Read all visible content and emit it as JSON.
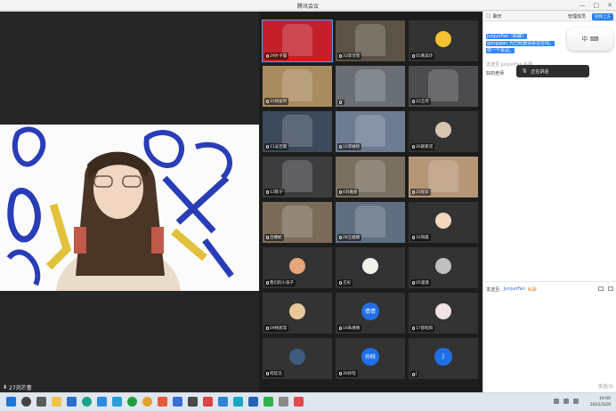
{
  "window": {
    "title": "腾讯会议",
    "min_glyph": "—",
    "max_glyph": "□",
    "close_glyph": "✕"
  },
  "main_video": {
    "speaker_name": "27刘芒蕾",
    "speaker_mic_icon": "mic-icon"
  },
  "participants": [
    {
      "label": "29叶子晨",
      "kind": "video",
      "bg": "#c3202a"
    },
    {
      "label": "33李可欣",
      "kind": "video",
      "bg": "#5b5346"
    },
    {
      "label": "05黄美玲",
      "kind": "avatar",
      "bg": "#2b2b2b",
      "avatar_color": "#f2c230"
    },
    {
      "label": "31杨盈珂",
      "kind": "video",
      "bg": "#a88c5e"
    },
    {
      "label": "",
      "kind": "video",
      "bg": "#6a6f75"
    },
    {
      "label": "22王芮",
      "kind": "video",
      "bg": "#4b4b50"
    },
    {
      "label": "11吴佳晨",
      "kind": "video",
      "bg": "#3c4a5c"
    },
    {
      "label": "10李敏彤",
      "kind": "video",
      "bg": "#6d7c93"
    },
    {
      "label": "26颜家诺",
      "kind": "avatar",
      "bg": "#2f2f2f",
      "avatar_color": "#d9c6b2"
    },
    {
      "label": "13陈宁",
      "kind": "video",
      "bg": "#3d3d40"
    },
    {
      "label": "4刘雅丽",
      "kind": "video",
      "bg": "#7a7060"
    },
    {
      "label": "25程军",
      "kind": "video",
      "bg": "#b59777"
    },
    {
      "label": "吕娜妮",
      "kind": "video",
      "bg": "#7b6c5a"
    },
    {
      "label": "28王雅楠",
      "kind": "video",
      "bg": "#5f6f80"
    },
    {
      "label": "32阳晨",
      "kind": "avatar",
      "bg": "#2f2f2f",
      "avatar_color": "#f0d7bd"
    },
    {
      "label": "我们的小孩子",
      "kind": "avatar",
      "bg": "#2f2f2f",
      "avatar_color": "#e6a67a"
    },
    {
      "label": "王祀",
      "kind": "avatar",
      "bg": "#2f2f2f",
      "avatar_color": "#f5f0ea"
    },
    {
      "label": "05潇潇",
      "kind": "avatar",
      "bg": "#2f2f2f",
      "avatar_color": "#bfbfbf"
    },
    {
      "label": "09杨宸常",
      "kind": "avatar",
      "bg": "#2f2f2f",
      "avatar_color": "#e7c79a"
    },
    {
      "label": "19朱倩倩",
      "kind": "avatar_text",
      "bg": "#2f2f2f",
      "avatar_text": "倩倩"
    },
    {
      "label": "17邵程阳",
      "kind": "avatar",
      "bg": "#2f2f2f",
      "avatar_color": "#f2e2e2"
    },
    {
      "label": "何延沅",
      "kind": "avatar",
      "bg": "#2f2f2f",
      "avatar_color": "#3f5b7f"
    },
    {
      "label": "30孙晗",
      "kind": "avatar_text",
      "bg": "#2f2f2f",
      "avatar_text": "孙晗"
    },
    {
      "label": "J",
      "kind": "avatar_text",
      "bg": "#2f2f2f",
      "avatar_text": "J"
    }
  ],
  "chat": {
    "tab_label": "聊天",
    "manage_label": "管理成员",
    "header_button": "回到上方",
    "msg_sender": "JunjunFan（私聊）",
    "msg_line1": "gongqian 为已经邀请会议在线。",
    "msg_line2": "体一个会议。",
    "msg_meta": "发送至 JunjunFan 私聊",
    "msg_line3": "好的老师",
    "toast_text": "正在讲话",
    "ime_text": "中 ⌨",
    "send_to_label": "发送至:",
    "send_to_user": "JunjunFan",
    "send_to_mode": "私聊",
    "send_button": "发送(S)"
  },
  "taskbar": {
    "time": "19:06",
    "date": "2022/3/29"
  },
  "colors": {
    "accent": "#1f7ee8",
    "active_border": "#4ea0ff",
    "tile_bg": "#333333"
  }
}
